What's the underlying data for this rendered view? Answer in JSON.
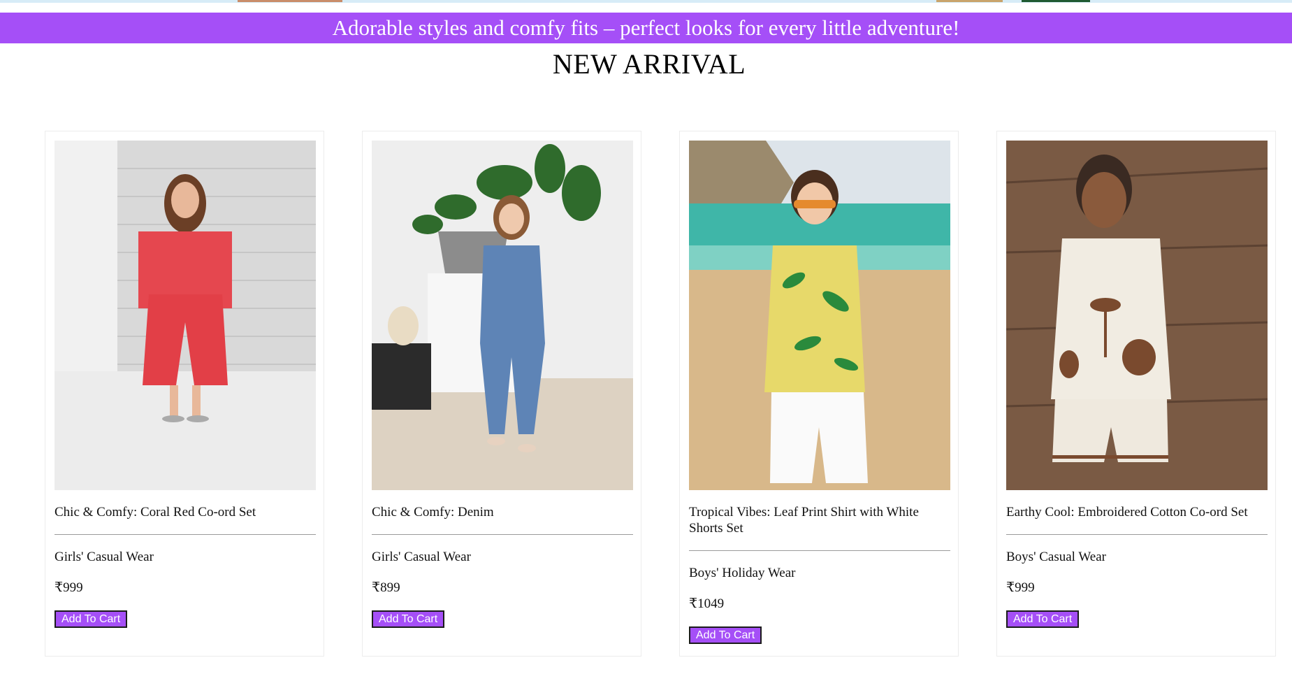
{
  "promo": {
    "text": "Adorable styles and comfy fits – perfect looks for every little adventure!"
  },
  "section": {
    "title": "NEW ARRIVAL"
  },
  "colors": {
    "accent": "#a54ff7",
    "button_border": "#1b1b1b"
  },
  "products": [
    {
      "name": "Chic & Comfy: Coral Red Co-ord Set",
      "category": "Girls' Casual Wear",
      "price": "₹999",
      "button": "Add To Cart",
      "image": "girl-in-coral-red-coord-set-photo"
    },
    {
      "name": "Chic & Comfy: Denim",
      "category": "Girls' Casual Wear",
      "price": "₹899",
      "button": "Add To Cart",
      "image": "girl-in-denim-jumpsuit-photo"
    },
    {
      "name": "Tropical Vibes: Leaf Print Shirt with White Shorts Set",
      "category": "Boys' Holiday Wear",
      "price": "₹1049",
      "button": "Add To Cart",
      "image": "boy-in-leaf-print-shirt-on-beach-photo"
    },
    {
      "name": "Earthy Cool: Embroidered Cotton Co-ord Set",
      "category": "Boys' Casual Wear",
      "price": "₹999",
      "button": "Add To Cart",
      "image": "boy-in-embroidered-cotton-set-photo"
    }
  ]
}
